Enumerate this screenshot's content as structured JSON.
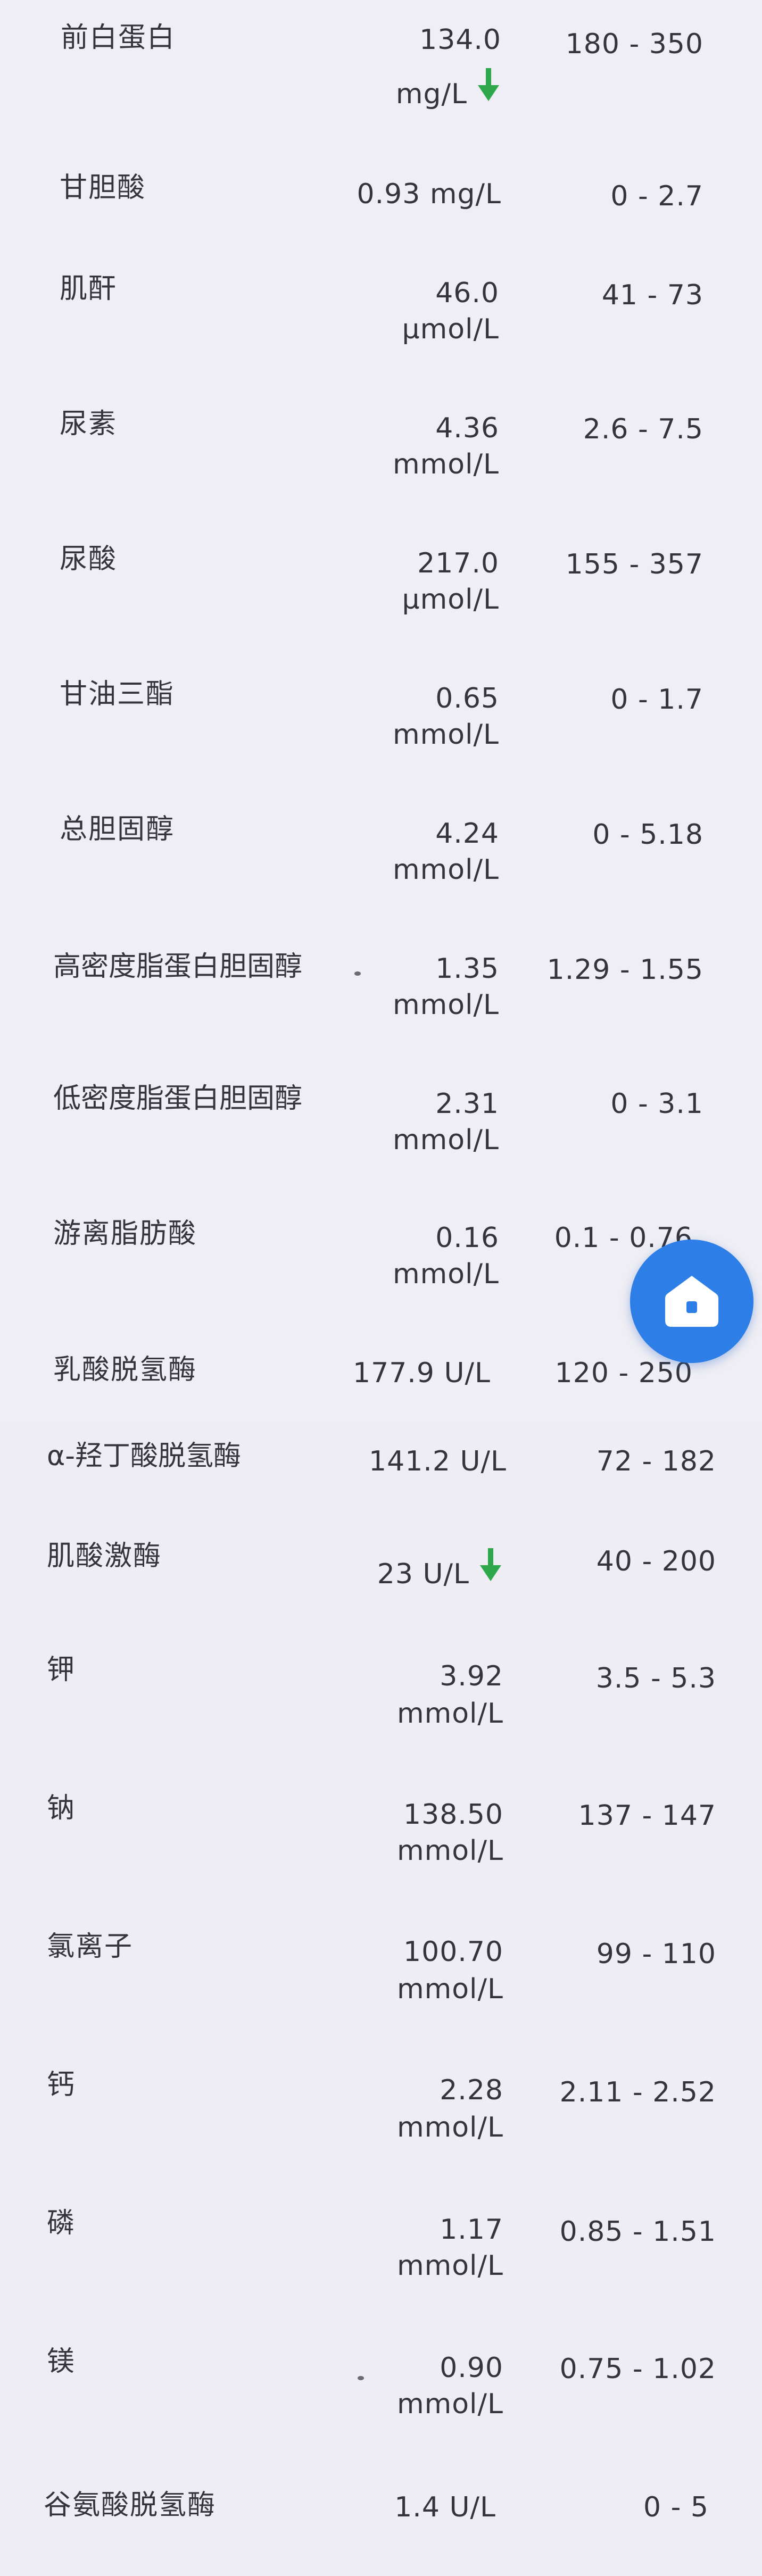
{
  "colors": {
    "arrow_down": "#2ea84a",
    "home_button": "#2d7ee6"
  },
  "rows": [
    {
      "name": "前白蛋白",
      "value": "134.0",
      "unit": "mg/L",
      "range": "180 - 350",
      "flag": "down"
    },
    {
      "name": "甘胆酸",
      "value": "0.93 mg/L",
      "unit": "",
      "range": "0 - 2.7"
    },
    {
      "name": "肌酐",
      "value": "46.0",
      "unit": "μmol/L",
      "range": "41 - 73"
    },
    {
      "name": "尿素",
      "value": "4.36",
      "unit": "mmol/L",
      "range": "2.6 - 7.5"
    },
    {
      "name": "尿酸",
      "value": "217.0",
      "unit": "μmol/L",
      "range": "155 - 357"
    },
    {
      "name": "甘油三酯",
      "value": "0.65",
      "unit": "mmol/L",
      "range": "0 - 1.7"
    },
    {
      "name": "总胆固醇",
      "value": "4.24",
      "unit": "mmol/L",
      "range": "0 - 5.18"
    },
    {
      "name": "高密度脂蛋白胆固醇",
      "value": "1.35",
      "unit": "mmol/L",
      "range": "1.29 - 1.55"
    },
    {
      "name": "低密度脂蛋白胆固醇",
      "value": "2.31",
      "unit": "mmol/L",
      "range": "0 - 3.1"
    },
    {
      "name": "游离脂肪酸",
      "value": "0.16",
      "unit": "mmol/L",
      "range": "0.1 - 0.76"
    },
    {
      "name": "乳酸脱氢酶",
      "value": "177.9 U/L",
      "unit": "",
      "range": "120 - 250"
    },
    {
      "name": "α-羟丁酸脱氢酶",
      "value": "141.2 U/L",
      "unit": "",
      "range": "72 - 182"
    },
    {
      "name": "肌酸激酶",
      "value": "23 U/L",
      "unit": "",
      "range": "40 - 200",
      "flag": "down"
    },
    {
      "name": "钾",
      "value": "3.92",
      "unit": "mmol/L",
      "range": "3.5 - 5.3"
    },
    {
      "name": "钠",
      "value": "138.50",
      "unit": "mmol/L",
      "range": "137 - 147"
    },
    {
      "name": "氯离子",
      "value": "100.70",
      "unit": "mmol/L",
      "range": "99 - 110"
    },
    {
      "name": "钙",
      "value": "2.28",
      "unit": "mmol/L",
      "range": "2.11 - 2.52"
    },
    {
      "name": "磷",
      "value": "1.17",
      "unit": "mmol/L",
      "range": "0.85 - 1.51"
    },
    {
      "name": "镁",
      "value": "0.90",
      "unit": "mmol/L",
      "range": "0.75 - 1.02"
    },
    {
      "name": "谷氨酸脱氢酶",
      "value": "1.4 U/L",
      "unit": "",
      "range": "0 - 5"
    }
  ]
}
